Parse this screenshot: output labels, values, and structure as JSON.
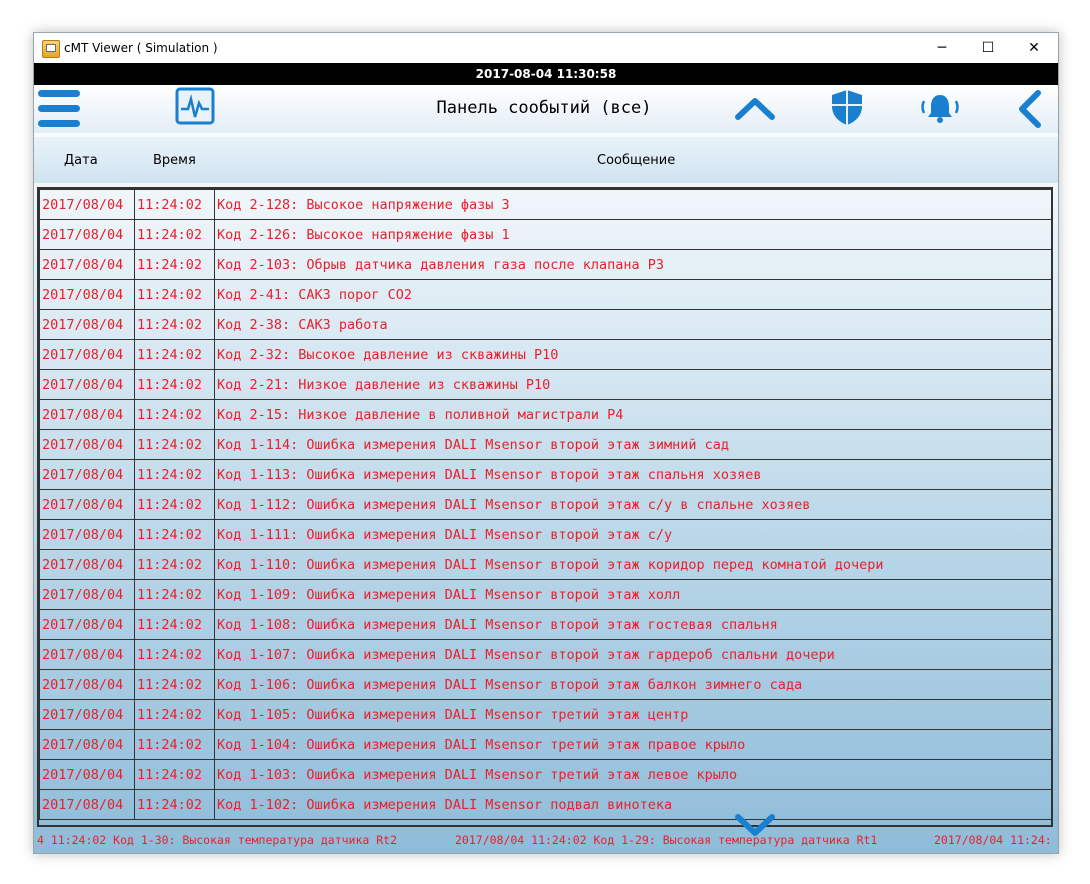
{
  "window": {
    "title": "cMT Viewer ( Simulation )",
    "minimize": "─",
    "maximize": "☐",
    "close": "✕"
  },
  "status": {
    "datetime": "2017-08-04 11:30:58"
  },
  "toolbar": {
    "title": "Панель сообытий (все)",
    "icons": [
      "menu-icon",
      "trend-monitor-icon",
      "scroll-up-icon",
      "shield-icon",
      "alarm-bell-icon",
      "back-icon"
    ],
    "accent": "#1a7fce"
  },
  "columns": {
    "date": "Дата",
    "time": "Время",
    "message": "Сообщение"
  },
  "events": [
    {
      "date": "2017/08/04",
      "time": "11:24:02",
      "message": "Код 2-128: Высокое напряжение фазы 3"
    },
    {
      "date": "2017/08/04",
      "time": "11:24:02",
      "message": "Код 2-126: Высокое напряжение фазы 1"
    },
    {
      "date": "2017/08/04",
      "time": "11:24:02",
      "message": "Код 2-103: Обрыв  датчика давления газа после клапана Р3"
    },
    {
      "date": "2017/08/04",
      "time": "11:24:02",
      "message": "Код 2-41: САКЗ порог СО2"
    },
    {
      "date": "2017/08/04",
      "time": "11:24:02",
      "message": "Код 2-38: САКЗ работа"
    },
    {
      "date": "2017/08/04",
      "time": "11:24:02",
      "message": "Код 2-32: Высокое давление из скважины Р10"
    },
    {
      "date": "2017/08/04",
      "time": "11:24:02",
      "message": "Код 2-21: Низкое давление из скважины Р10"
    },
    {
      "date": "2017/08/04",
      "time": "11:24:02",
      "message": "Код 2-15: Низкое давление в поливной магистрали Р4"
    },
    {
      "date": "2017/08/04",
      "time": "11:24:02",
      "message": "Код 1-114: Ошибка измерения DALI Msensor второй этаж зимний сад"
    },
    {
      "date": "2017/08/04",
      "time": "11:24:02",
      "message": "Код 1-113: Ошибка измерения DALI Msensor второй этаж спальня хозяев"
    },
    {
      "date": "2017/08/04",
      "time": "11:24:02",
      "message": "Код 1-112: Ошибка измерения DALI Msensor второй этаж с/у в спальне хозяев"
    },
    {
      "date": "2017/08/04",
      "time": "11:24:02",
      "message": "Код 1-111: Ошибка измерения DALI Msensor второй этаж с/у"
    },
    {
      "date": "2017/08/04",
      "time": "11:24:02",
      "message": "Код 1-110: Ошибка измерения DALI Msensor второй этаж коридор перед комнатой дочери"
    },
    {
      "date": "2017/08/04",
      "time": "11:24:02",
      "message": "Код 1-109: Ошибка измерения DALI Msensor второй этаж холл"
    },
    {
      "date": "2017/08/04",
      "time": "11:24:02",
      "message": "Код 1-108: Ошибка измерения DALI Msensor второй этаж гостевая спальня"
    },
    {
      "date": "2017/08/04",
      "time": "11:24:02",
      "message": "Код 1-107: Ошибка измерения DALI Msensor второй этаж гардероб спальни дочери"
    },
    {
      "date": "2017/08/04",
      "time": "11:24:02",
      "message": "Код 1-106: Ошибка измерения DALI Msensor второй этаж балкон зимнего сада"
    },
    {
      "date": "2017/08/04",
      "time": "11:24:02",
      "message": "Код 1-105: Ошибка измерения DALI Msensor третий этаж центр"
    },
    {
      "date": "2017/08/04",
      "time": "11:24:02",
      "message": "Код 1-104: Ошибка измерения DALI Msensor третий этаж правое крыло"
    },
    {
      "date": "2017/08/04",
      "time": "11:24:02",
      "message": "Код 1-103: Ошибка измерения DALI Msensor третий этаж левое крыло"
    },
    {
      "date": "2017/08/04",
      "time": "11:24:02",
      "message": "Код 1-102: Ошибка измерения DALI Msensor подвал винотека"
    }
  ],
  "ticker": [
    "4 11:24:02 Код 1-30: Высокая температура датчика Rt2",
    "2017/08/04 11:24:02 Код 1-29: Высокая температура датчика Rt1",
    "2017/08/04 11:24:"
  ],
  "colors": {
    "event_text": "#e8212b",
    "accent": "#1a7fce"
  }
}
